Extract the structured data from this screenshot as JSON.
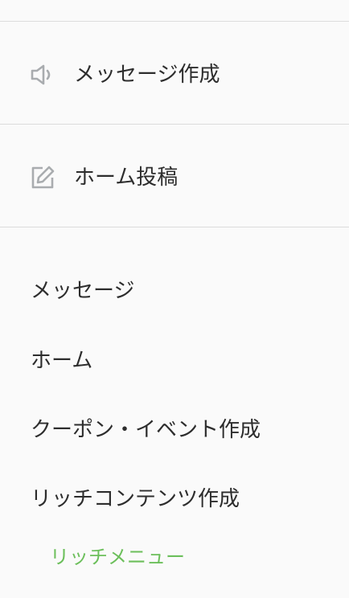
{
  "actions": [
    {
      "label": "メッセージ作成",
      "icon": "megaphone-icon"
    },
    {
      "label": "ホーム投稿",
      "icon": "edit-icon"
    }
  ],
  "menu": [
    {
      "label": "メッセージ"
    },
    {
      "label": "ホーム"
    },
    {
      "label": "クーポン・イベント作成"
    },
    {
      "label": "リッチコンテンツ作成"
    }
  ],
  "submenu": [
    {
      "label": "リッチメニュー"
    }
  ],
  "colors": {
    "background": "#fafafa",
    "divider": "#dcdcdc",
    "icon": "#a9acaf",
    "text": "#2d2d2d",
    "accent": "#6cbf5b"
  }
}
